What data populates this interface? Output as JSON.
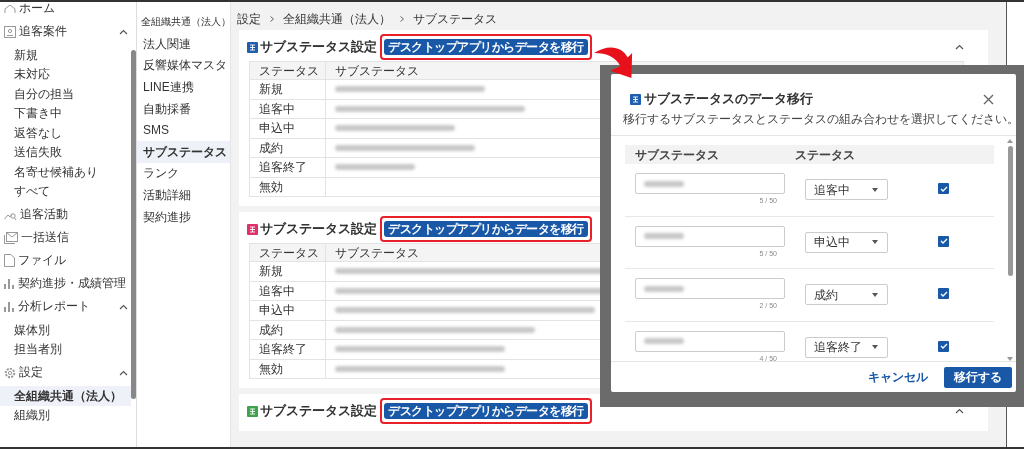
{
  "sidebar": {
    "items": [
      {
        "label": "ホーム"
      },
      {
        "label": "追客案件",
        "expanded": true,
        "children": [
          {
            "label": "新規",
            "selected": false
          },
          {
            "label": "未対応",
            "selected": false
          },
          {
            "label": "自分の担当",
            "selected": false
          },
          {
            "label": "下書き中",
            "selected": false
          },
          {
            "label": "返答なし",
            "selected": false
          },
          {
            "label": "送信失敗",
            "selected": false
          },
          {
            "label": "名寄せ候補あり",
            "selected": false
          },
          {
            "label": "すべて",
            "selected": false
          }
        ]
      },
      {
        "label": "追客活動"
      },
      {
        "label": "一括送信"
      },
      {
        "label": "ファイル"
      },
      {
        "label": "契約進捗・成績管理"
      },
      {
        "label": "分析レポート",
        "expanded": true,
        "children": [
          {
            "label": "媒体別",
            "selected": false
          },
          {
            "label": "担当者別",
            "selected": false
          }
        ]
      },
      {
        "label": "設定",
        "expanded": true,
        "children": [
          {
            "label": "全組織共通（法人）",
            "selected": true
          },
          {
            "label": "組織別",
            "selected": false
          }
        ]
      }
    ]
  },
  "subnav": {
    "heading": "全組織共通（法人）",
    "items": [
      {
        "label": "法人関連",
        "selected": false
      },
      {
        "label": "反響媒体マスタ",
        "selected": false
      },
      {
        "label": "LINE連携",
        "selected": false
      },
      {
        "label": "自動採番",
        "selected": false
      },
      {
        "label": "SMS",
        "selected": false
      },
      {
        "label": "サブステータス",
        "selected": true
      },
      {
        "label": "ランク",
        "selected": false
      },
      {
        "label": "活動詳細",
        "selected": false
      },
      {
        "label": "契約進捗",
        "selected": false
      }
    ]
  },
  "breadcrumb": [
    "設定",
    "全組織共通（法人）",
    "サブステータス"
  ],
  "sections": [
    {
      "color": "#1f5fae",
      "title": "サブステータス設定",
      "button": "デスクトップアプリからデータを移行",
      "expanded": true,
      "columns": [
        "ステータス",
        "サブステータス"
      ],
      "rows": [
        "新規",
        "追客中",
        "申込中",
        "成約",
        "追客終了",
        "無効"
      ]
    },
    {
      "color": "#e0306a",
      "title": "サブステータス設定",
      "button": "デスクトップアプリからデータを移行",
      "columns": [
        "ステータス",
        "サブステータス"
      ],
      "rows": [
        "新規",
        "追客中",
        "申込中",
        "成約",
        "追客終了",
        "無効"
      ]
    },
    {
      "color": "#3fa34d",
      "title": "サブステータス設定",
      "button": "デスクトップアプリからデータを移行",
      "expanded": true
    }
  ],
  "dialog": {
    "title": "サブステータスのデータ移行",
    "description": "移行するサブステータスとステータスの組み合わせを選択してください。",
    "columns": [
      "サブステータス",
      "ステータス"
    ],
    "rows": [
      {
        "counter": "5 / 50",
        "status": "追客中",
        "checked": true
      },
      {
        "counter": "5 / 50",
        "status": "申込中",
        "checked": true
      },
      {
        "counter": "2 / 50",
        "status": "成約",
        "checked": true
      },
      {
        "counter": "4 / 50",
        "status": "追客終了",
        "checked": true
      }
    ],
    "buttons": [
      {
        "label": "キャンセル",
        "kind": "text"
      },
      {
        "label": "移行する",
        "kind": "primary"
      }
    ]
  }
}
